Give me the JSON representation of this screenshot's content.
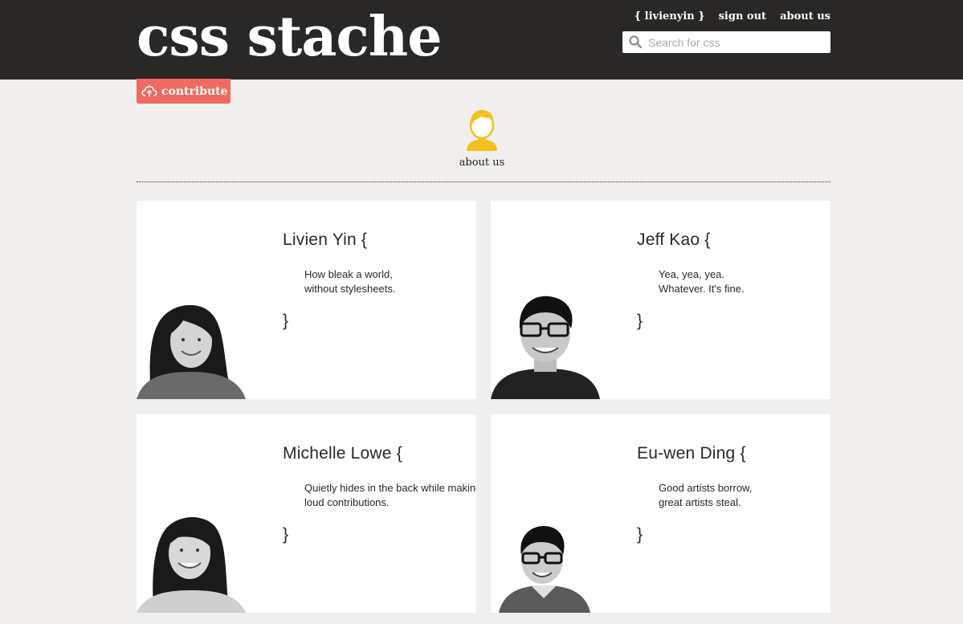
{
  "header": {
    "logo": "css stache",
    "nav": {
      "user": "{ livienyin }",
      "sign_out": "sign out",
      "about": "about us"
    },
    "search_placeholder": "Search for css"
  },
  "contribute_label": "contribute",
  "hero": {
    "icon": "person-icon",
    "label": "about us"
  },
  "members": [
    {
      "name": "Livien Yin {",
      "quote_line1": "How bleak a world,",
      "quote_line2": "without stylesheets.",
      "close": "}"
    },
    {
      "name": "Jeff Kao {",
      "quote_line1": "Yea, yea, yea.",
      "quote_line2": "Whatever. It's fine.",
      "close": "}"
    },
    {
      "name": "Michelle Lowe {",
      "quote_line1": "Quietly hides in the back while making",
      "quote_line2": "loud contributions.",
      "close": "}"
    },
    {
      "name": "Eu-wen Ding {",
      "quote_line1": "Good artists borrow,",
      "quote_line2": "great artists steal.",
      "close": "}"
    }
  ],
  "colors": {
    "header_bg": "#2a2826",
    "page_bg": "#f0efed",
    "contribute": "#ef6a60",
    "hero_icon": "#f5c01f"
  }
}
